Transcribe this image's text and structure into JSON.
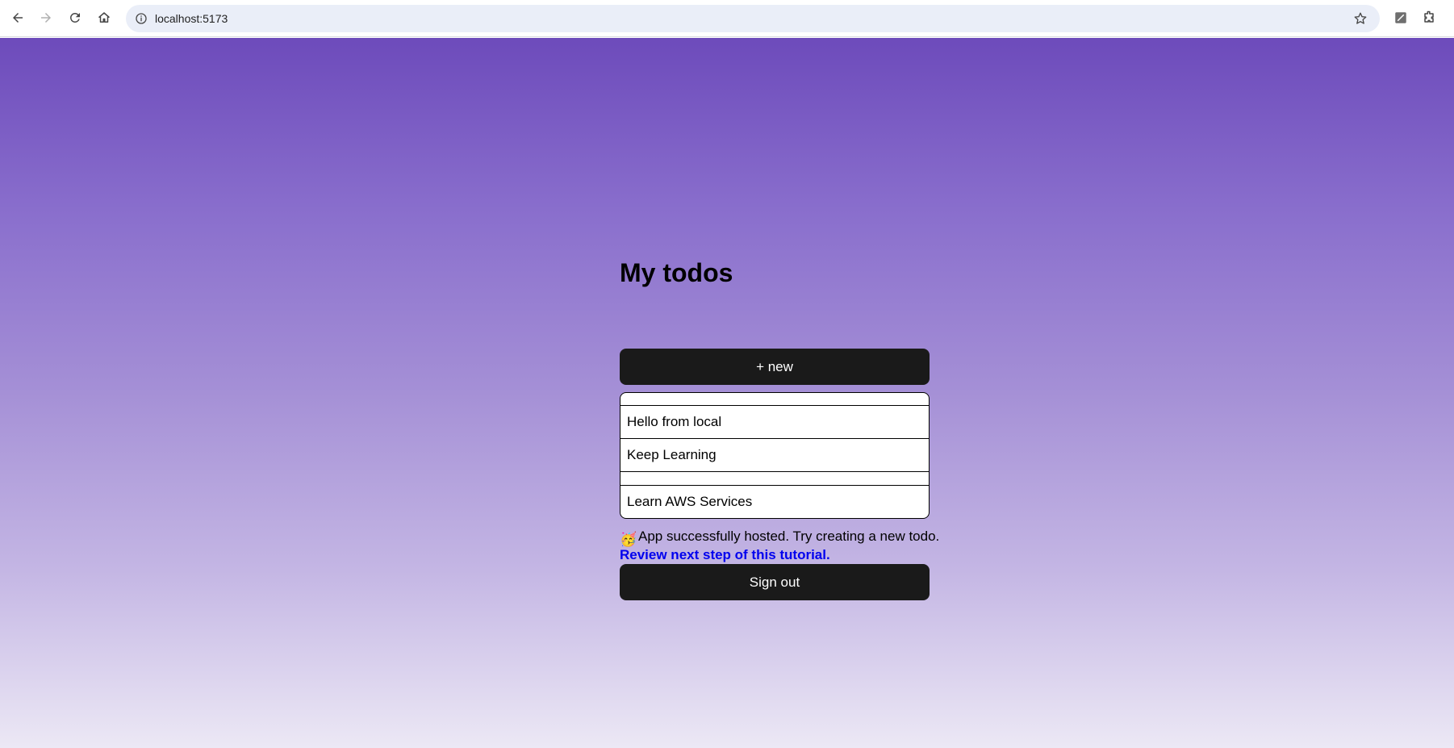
{
  "browser": {
    "url": "localhost:5173",
    "back_icon": "arrow-left-icon",
    "forward_icon": "arrow-right-icon",
    "reload_icon": "reload-icon",
    "home_icon": "home-icon",
    "info_icon": "info-icon",
    "bookmark_icon": "star-icon",
    "extension_icons": [
      "pen-extension-icon",
      "puzzle-icon"
    ]
  },
  "app": {
    "title": "My todos",
    "new_button_label": "+ new",
    "todos": [
      {
        "content": ""
      },
      {
        "content": "Hello from local"
      },
      {
        "content": "Keep Learning"
      },
      {
        "content": ""
      },
      {
        "content": "Learn AWS Services"
      }
    ],
    "status_message": "App successfully hosted. Try creating a new todo.",
    "status_emoji": "🥳",
    "tutorial_link": "Review next step of this tutorial.",
    "sign_out_label": "Sign out"
  },
  "colors": {
    "gradient_top": "#6d4bbb",
    "gradient_bottom": "#ece8f5",
    "button_bg": "#1a1a1a",
    "link": "#0000ee"
  }
}
